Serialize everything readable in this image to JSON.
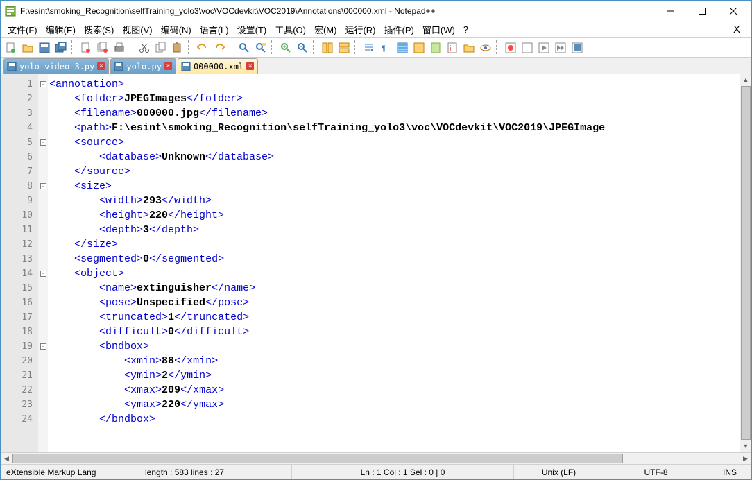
{
  "window": {
    "title": "F:\\esint\\smoking_Recognition\\selfTraining_yolo3\\voc\\VOCdevkit\\VOC2019\\Annotations\\000000.xml - Notepad++"
  },
  "menu": {
    "file": "文件(F)",
    "edit": "编辑(E)",
    "search": "搜索(S)",
    "view": "视图(V)",
    "encoding": "编码(N)",
    "language": "语言(L)",
    "settings": "设置(T)",
    "tools": "工具(O)",
    "macro": "宏(M)",
    "run": "运行(R)",
    "plugins": "插件(P)",
    "window": "窗口(W)",
    "help": "?"
  },
  "tabs": {
    "t1": "yolo_video_3.py",
    "t2": "yolo.py",
    "t3": "000000.xml"
  },
  "code": {
    "l1": "<annotation>",
    "l2_open": "<folder>",
    "l2_val": "JPEGImages",
    "l2_close": "</folder>",
    "l3_open": "<filename>",
    "l3_val": "000000.jpg",
    "l3_close": "</filename>",
    "l4_open": "<path>",
    "l4_val": "F:\\esint\\smoking_Recognition\\selfTraining_yolo3\\voc\\VOCdevkit\\VOC2019\\JPEGImage",
    "l5": "<source>",
    "l6_open": "<database>",
    "l6_val": "Unknown",
    "l6_close": "</database>",
    "l7": "</source>",
    "l8": "<size>",
    "l9_open": "<width>",
    "l9_val": "293",
    "l9_close": "</width>",
    "l10_open": "<height>",
    "l10_val": "220",
    "l10_close": "</height>",
    "l11_open": "<depth>",
    "l11_val": "3",
    "l11_close": "</depth>",
    "l12": "</size>",
    "l13_open": "<segmented>",
    "l13_val": "0",
    "l13_close": "</segmented>",
    "l14": "<object>",
    "l15_open": "<name>",
    "l15_val": "extinguisher",
    "l15_close": "</name>",
    "l16_open": "<pose>",
    "l16_val": "Unspecified",
    "l16_close": "</pose>",
    "l17_open": "<truncated>",
    "l17_val": "1",
    "l17_close": "</truncated>",
    "l18_open": "<difficult>",
    "l18_val": "0",
    "l18_close": "</difficult>",
    "l19": "<bndbox>",
    "l20_open": "<xmin>",
    "l20_val": "88",
    "l20_close": "</xmin>",
    "l21_open": "<ymin>",
    "l21_val": "2",
    "l21_close": "</ymin>",
    "l22_open": "<xmax>",
    "l22_val": "209",
    "l22_close": "</xmax>",
    "l23_open": "<ymax>",
    "l23_val": "220",
    "l23_close": "</ymax>",
    "l24": "</bndbox>"
  },
  "gutter": [
    "1",
    "2",
    "3",
    "4",
    "5",
    "6",
    "7",
    "8",
    "9",
    "10",
    "11",
    "12",
    "13",
    "14",
    "15",
    "16",
    "17",
    "18",
    "19",
    "20",
    "21",
    "22",
    "23",
    "24"
  ],
  "status": {
    "lang": "eXtensible Markup Lang",
    "length": "length : 583    lines : 27",
    "pos": "Ln : 1    Col : 1    Sel : 0 | 0",
    "eol": "Unix (LF)",
    "enc": "UTF-8",
    "mode": "INS"
  },
  "icons": {
    "fold_minus": "−"
  }
}
